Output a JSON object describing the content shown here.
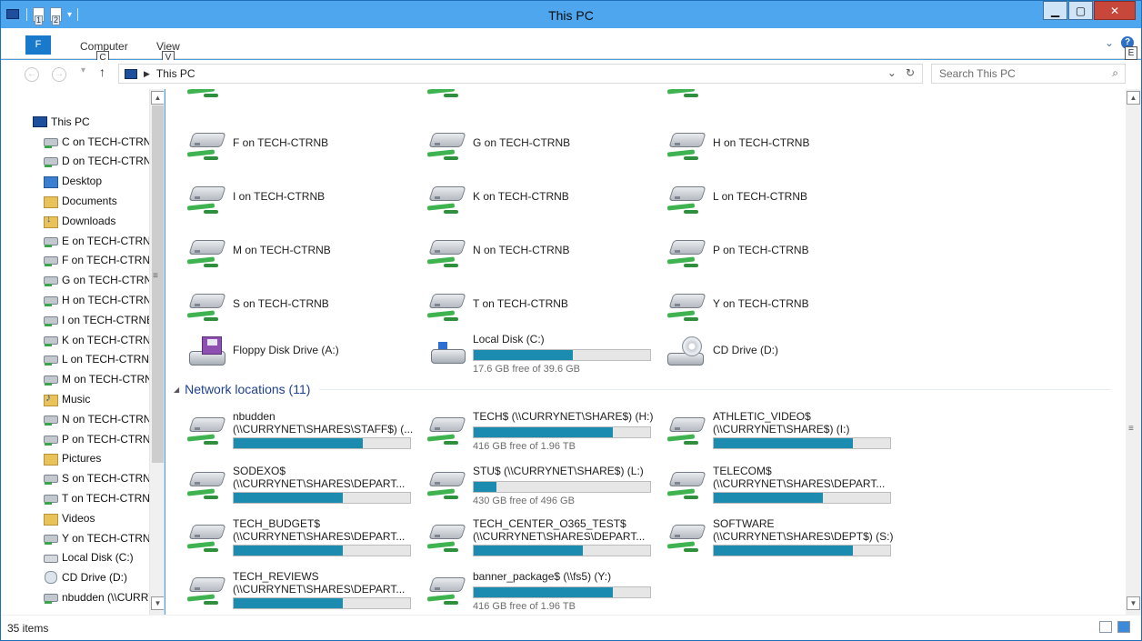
{
  "window": {
    "title": "This PC"
  },
  "ribbon": {
    "file_label": "F",
    "tabs": [
      {
        "label": "Computer",
        "keytip": "C"
      },
      {
        "label": "View",
        "keytip": "V"
      }
    ],
    "qat_keytips": [
      "1",
      "2"
    ],
    "help_keytip": "E"
  },
  "address": {
    "crumb": "This PC",
    "search_placeholder": "Search This PC"
  },
  "nav": {
    "items": [
      {
        "label": "This PC",
        "icon": "pc",
        "root": true
      },
      {
        "label": "C on TECH-CTRNB",
        "icon": "drive"
      },
      {
        "label": "D on TECH-CTRNB",
        "icon": "drive"
      },
      {
        "label": "Desktop",
        "icon": "desktop"
      },
      {
        "label": "Documents",
        "icon": "folder"
      },
      {
        "label": "Downloads",
        "icon": "downloads"
      },
      {
        "label": "E on TECH-CTRNB",
        "icon": "drive"
      },
      {
        "label": "F on TECH-CTRNB",
        "icon": "drive"
      },
      {
        "label": "G on TECH-CTRNB",
        "icon": "drive"
      },
      {
        "label": "H on TECH-CTRNB",
        "icon": "drive"
      },
      {
        "label": "I on TECH-CTRNB",
        "icon": "drive"
      },
      {
        "label": "K on TECH-CTRNB",
        "icon": "drive"
      },
      {
        "label": "L on TECH-CTRNB",
        "icon": "drive"
      },
      {
        "label": "M on TECH-CTRNB",
        "icon": "drive"
      },
      {
        "label": "Music",
        "icon": "music"
      },
      {
        "label": "N on TECH-CTRNB",
        "icon": "drive"
      },
      {
        "label": "P on TECH-CTRNB",
        "icon": "drive"
      },
      {
        "label": "Pictures",
        "icon": "folder"
      },
      {
        "label": "S on TECH-CTRNB",
        "icon": "drive"
      },
      {
        "label": "T on TECH-CTRNB",
        "icon": "drive"
      },
      {
        "label": "Videos",
        "icon": "folder"
      },
      {
        "label": "Y on TECH-CTRNB",
        "icon": "drive"
      },
      {
        "label": "Local Disk (C:)",
        "icon": "disk"
      },
      {
        "label": "CD Drive (D:)",
        "icon": "cd"
      },
      {
        "label": "nbudden (\\\\CURRYNET\\SHARES\\STAFF$) (H:)",
        "icon": "drive"
      }
    ]
  },
  "drives": [
    {
      "label": "F on TECH-CTRNB"
    },
    {
      "label": "G on TECH-CTRNB"
    },
    {
      "label": "H on TECH-CTRNB"
    },
    {
      "label": "I on TECH-CTRNB"
    },
    {
      "label": "K on TECH-CTRNB"
    },
    {
      "label": "L on TECH-CTRNB"
    },
    {
      "label": "M on TECH-CTRNB"
    },
    {
      "label": "N on TECH-CTRNB"
    },
    {
      "label": "P on TECH-CTRNB"
    },
    {
      "label": "S on TECH-CTRNB"
    },
    {
      "label": "T on TECH-CTRNB"
    },
    {
      "label": "Y on TECH-CTRNB"
    }
  ],
  "devices": [
    {
      "label": "Floppy Disk Drive (A:)",
      "icon": "floppy"
    },
    {
      "label": "Local Disk (C:)",
      "icon": "local-disk",
      "free_text": "17.6 GB free of 39.6 GB",
      "used_fraction": 0.56
    },
    {
      "label": "CD Drive (D:)",
      "icon": "cd-drive"
    }
  ],
  "network": {
    "title": "Network locations (11)",
    "items": [
      {
        "name": "nbudden",
        "path": "(\\\\CURRYNET\\SHARES\\STAFF$) (...",
        "used_fraction": 0.73
      },
      {
        "name": "TECH$ (\\\\CURRYNET\\SHARE$) (H:)",
        "path": "",
        "used_fraction": 0.79,
        "free_text": "416 GB free of 1.96 TB"
      },
      {
        "name": "ATHLETIC_VIDEO$",
        "path": "(\\\\CURRYNET\\SHARE$) (I:)",
        "used_fraction": 0.79
      },
      {
        "name": "SODEXO$",
        "path": "(\\\\CURRYNET\\SHARES\\DEPART...",
        "used_fraction": 0.62
      },
      {
        "name": "STU$ (\\\\CURRYNET\\SHARE$) (L:)",
        "path": "",
        "used_fraction": 0.13,
        "free_text": "430 GB free of 496 GB"
      },
      {
        "name": "TELECOM$",
        "path": "(\\\\CURRYNET\\SHARES\\DEPART...",
        "used_fraction": 0.62
      },
      {
        "name": "TECH_BUDGET$",
        "path": "(\\\\CURRYNET\\SHARES\\DEPART...",
        "used_fraction": 0.62
      },
      {
        "name": "TECH_CENTER_O365_TEST$",
        "path": "(\\\\CURRYNET\\SHARES\\DEPART...",
        "used_fraction": 0.62
      },
      {
        "name": "SOFTWARE",
        "path": "(\\\\CURRYNET\\SHARES\\DEPT$) (S:)",
        "used_fraction": 0.79
      },
      {
        "name": "TECH_REVIEWS",
        "path": "(\\\\CURRYNET\\SHARES\\DEPART...",
        "used_fraction": 0.62
      },
      {
        "name": "banner_package$ (\\\\fs5) (Y:)",
        "path": "",
        "used_fraction": 0.79,
        "free_text": "416 GB free of 1.96 TB"
      }
    ]
  },
  "status": {
    "count": "35 items"
  }
}
